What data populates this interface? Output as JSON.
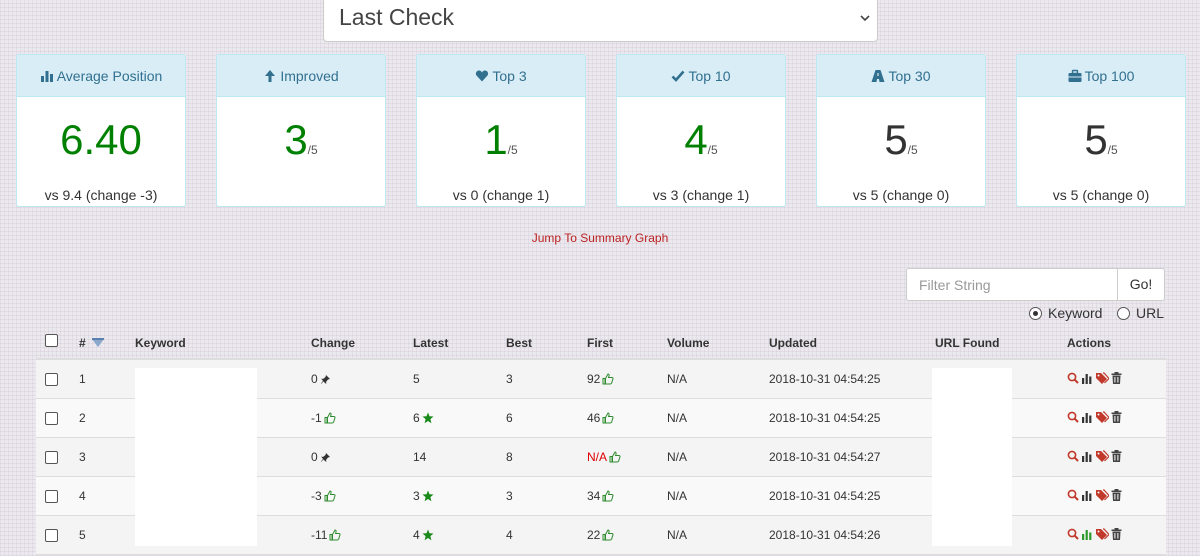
{
  "period_select": {
    "value": "Last Check"
  },
  "cards": [
    {
      "title": "Average Position",
      "icon": "bar-chart-icon",
      "value": "6.40",
      "suffix": "",
      "footer": "vs 9.4 (change -3)",
      "tone": "green"
    },
    {
      "title": "Improved",
      "icon": "arrow-up-icon",
      "value": "3",
      "suffix": "/5",
      "footer": "",
      "tone": "green"
    },
    {
      "title": "Top 3",
      "icon": "heart-icon",
      "value": "1",
      "suffix": "/5",
      "footer": "vs 0 (change 1)",
      "tone": "green"
    },
    {
      "title": "Top 10",
      "icon": "check-icon",
      "value": "4",
      "suffix": "/5",
      "footer": "vs 3 (change 1)",
      "tone": "green"
    },
    {
      "title": "Top 30",
      "icon": "road-icon",
      "value": "5",
      "suffix": "/5",
      "footer": "vs 5 (change 0)",
      "tone": "dark"
    },
    {
      "title": "Top 100",
      "icon": "briefcase-icon",
      "value": "5",
      "suffix": "/5",
      "footer": "vs 5 (change 0)",
      "tone": "dark"
    }
  ],
  "jump_link": "Jump To Summary Graph",
  "filter": {
    "placeholder": "Filter String",
    "button": "Go!"
  },
  "search_mode": {
    "options": [
      "Keyword",
      "URL"
    ],
    "selected": "Keyword"
  },
  "table": {
    "headers": [
      "#",
      "Keyword",
      "Change",
      "Latest",
      "Best",
      "First",
      "Volume",
      "Updated",
      "URL Found",
      "Actions"
    ],
    "rows": [
      {
        "num": "1",
        "change": "0",
        "change_icon": "pin-icon",
        "latest": "5",
        "latest_star": false,
        "best": "3",
        "first": "92",
        "first_na": false,
        "volume": "N/A",
        "updated": "2018-10-31 04:54:25"
      },
      {
        "num": "2",
        "change": "-1",
        "change_icon": "thumbs-up-icon",
        "latest": "6",
        "latest_star": true,
        "best": "6",
        "first": "46",
        "first_na": false,
        "volume": "N/A",
        "updated": "2018-10-31 04:54:25"
      },
      {
        "num": "3",
        "change": "0",
        "change_icon": "pin-icon",
        "latest": "14",
        "latest_star": false,
        "best": "8",
        "first": "N/A",
        "first_na": true,
        "volume": "N/A",
        "updated": "2018-10-31 04:54:27"
      },
      {
        "num": "4",
        "change": "-3",
        "change_icon": "thumbs-up-icon",
        "latest": "3",
        "latest_star": true,
        "best": "3",
        "first": "34",
        "first_na": false,
        "volume": "N/A",
        "updated": "2018-10-31 04:54:25"
      },
      {
        "num": "5",
        "change": "-11",
        "change_icon": "thumbs-up-icon",
        "latest": "4",
        "latest_star": true,
        "best": "4",
        "first": "22",
        "first_na": false,
        "volume": "N/A",
        "updated": "2018-10-31 04:54:26"
      }
    ]
  },
  "colors": {
    "good": "#008000",
    "bad": "#dd0000",
    "header_bg": "#d9edf7",
    "header_text": "#31708f",
    "link": "#bb2222"
  }
}
